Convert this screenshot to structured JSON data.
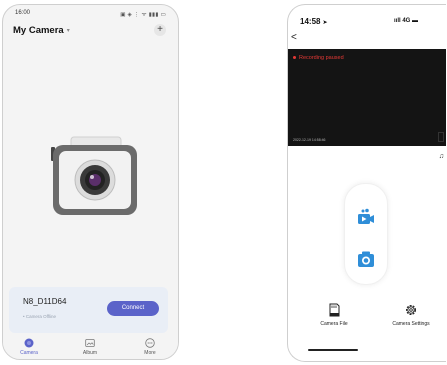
{
  "left_phone": {
    "status": {
      "time": "16:00",
      "icons_text": "▣ ◈ ⋮ ᯤ ▮▮▮ ▭"
    },
    "title": "My Camera",
    "title_caret": "▾",
    "add_label": "+",
    "device": {
      "name": "N8_D11D64",
      "status": "• Camera Offline",
      "connect_label": "Connect"
    },
    "tabs": [
      {
        "label": "Camera",
        "icon": "camera-tab-icon",
        "active": true
      },
      {
        "label": "Album",
        "icon": "album-icon",
        "active": false
      },
      {
        "label": "More",
        "icon": "more-icon",
        "active": false
      }
    ]
  },
  "right_phone": {
    "status": {
      "time": "14:58",
      "location_glyph": "➤",
      "signal_text": "ııll 4G ▬"
    },
    "back_glyph": "<",
    "recording_text": "Recording paused",
    "timestamp": "2022-12-19 14:58:46",
    "tabs": [
      {
        "label": "Camera File",
        "icon": "sd-card-icon"
      },
      {
        "label": "Camera Settings",
        "icon": "settings-gear-icon"
      }
    ]
  },
  "colors": {
    "accent": "#5b63c9",
    "recording": "#e53935",
    "capture_blue": "#2f8ed8",
    "card_bg": "#e9eef6"
  }
}
